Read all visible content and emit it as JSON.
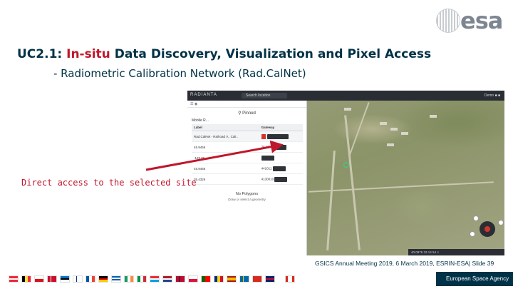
{
  "logo": {
    "word": "esa"
  },
  "title": {
    "prefix": "UC2.1: ",
    "accent": "In-situ",
    "rest": " Data Discovery, Visualization and Pixel Access"
  },
  "subtitle": "- Radiometric Calibration Network (Rad.CalNet)",
  "app": {
    "brand": "RADIANTA",
    "search_placeholder": "Search location",
    "top_right": "Demo  ■  ■",
    "panel": {
      "header": "☰   ◉",
      "pointer_label": "⚲ Pinned",
      "section_title": "Mobile R...",
      "table": {
        "headers": [
          "Label",
          "Gateway"
        ],
        "rows": [
          {
            "label": "Rad.CalNet - Railroad V., Cali..",
            "value": ""
          },
          {
            "label": "45.9456",
            "value": "76.4251"
          },
          {
            "label": "-125.06",
            "value": ""
          },
          {
            "label": "45.9456",
            "value": "441011"
          },
          {
            "label": "35.4326",
            "value": "4130010"
          }
        ]
      },
      "no_polygons": "No Polygons",
      "no_polygons_sub": "Draw or select a geometry"
    },
    "status": "40.0876   33.14   54  ≡"
  },
  "annotation": "Direct access to the selected site",
  "footer": "GSICS Annual Meeting 2019, 6 March 2019, ESRIN-ESA| Slide 39",
  "agency": "European Space Agency",
  "colors": {
    "navy": "#003247",
    "red": "#c0162b"
  }
}
